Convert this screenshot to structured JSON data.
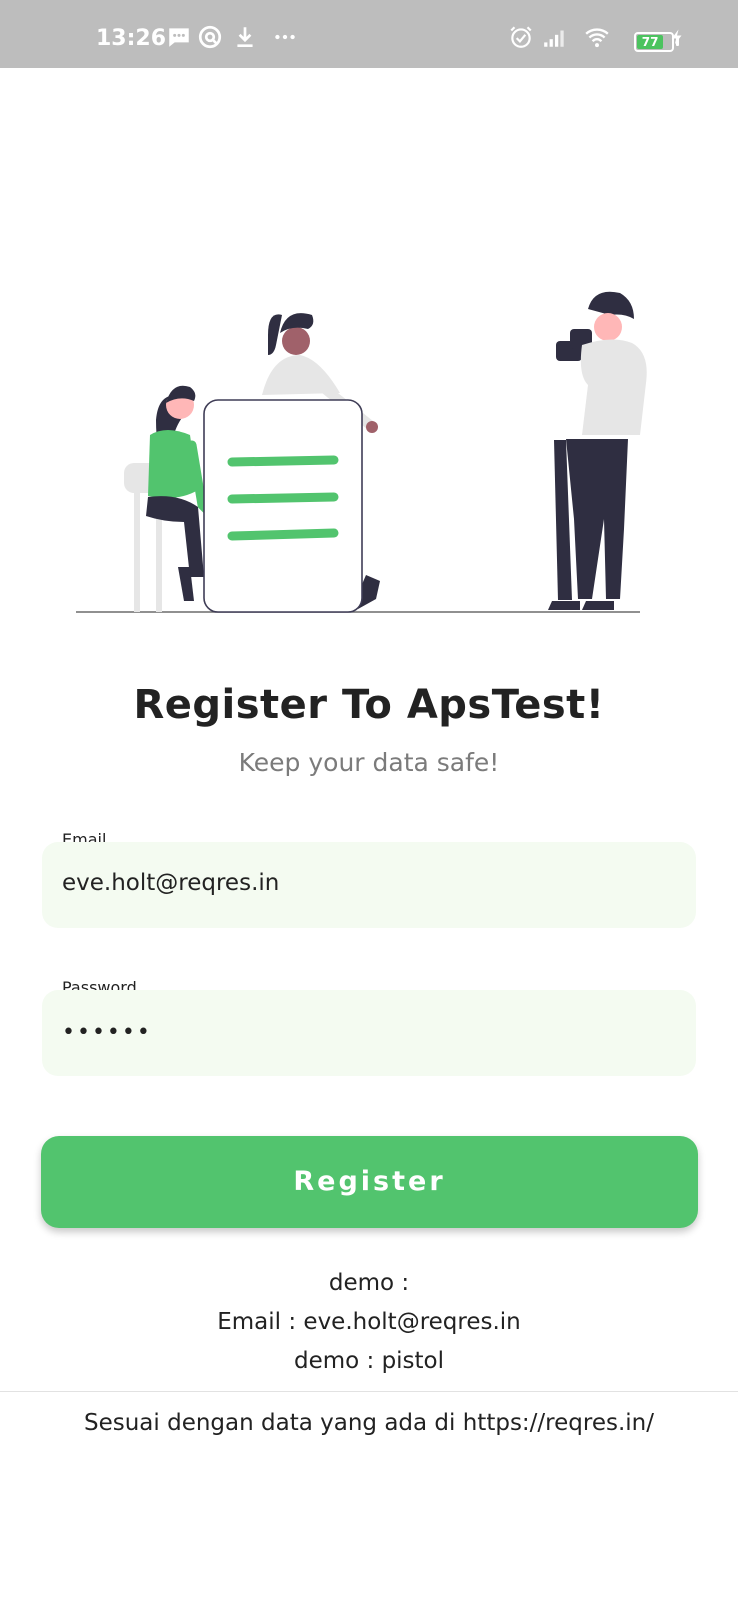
{
  "status_bar": {
    "time": "13:26",
    "battery_level": "77",
    "icons": [
      "message-icon",
      "sync-icon",
      "download-icon",
      "more-dots-icon",
      "alarm-icon",
      "signal-icon",
      "wifi-icon",
      "battery-icon",
      "charging-icon"
    ]
  },
  "header": {
    "title": "Register To ApsTest!",
    "subtitle": "Keep your data safe!"
  },
  "form": {
    "email_label": "Email",
    "email_value": "eve.holt@reqres.in",
    "password_label": "Password",
    "password_value": "••••••",
    "register_label": "Register"
  },
  "demo": {
    "line1": "demo :",
    "line2": "Email : eve.holt@reqres.in",
    "line3": "demo : pistol"
  },
  "footer": {
    "note": "Sesuai dengan data yang ada di https://reqres.in/"
  },
  "colors": {
    "accent": "#52c46e",
    "field_bg": "#f4fbf1",
    "status_bar": "#bdbdbd"
  }
}
